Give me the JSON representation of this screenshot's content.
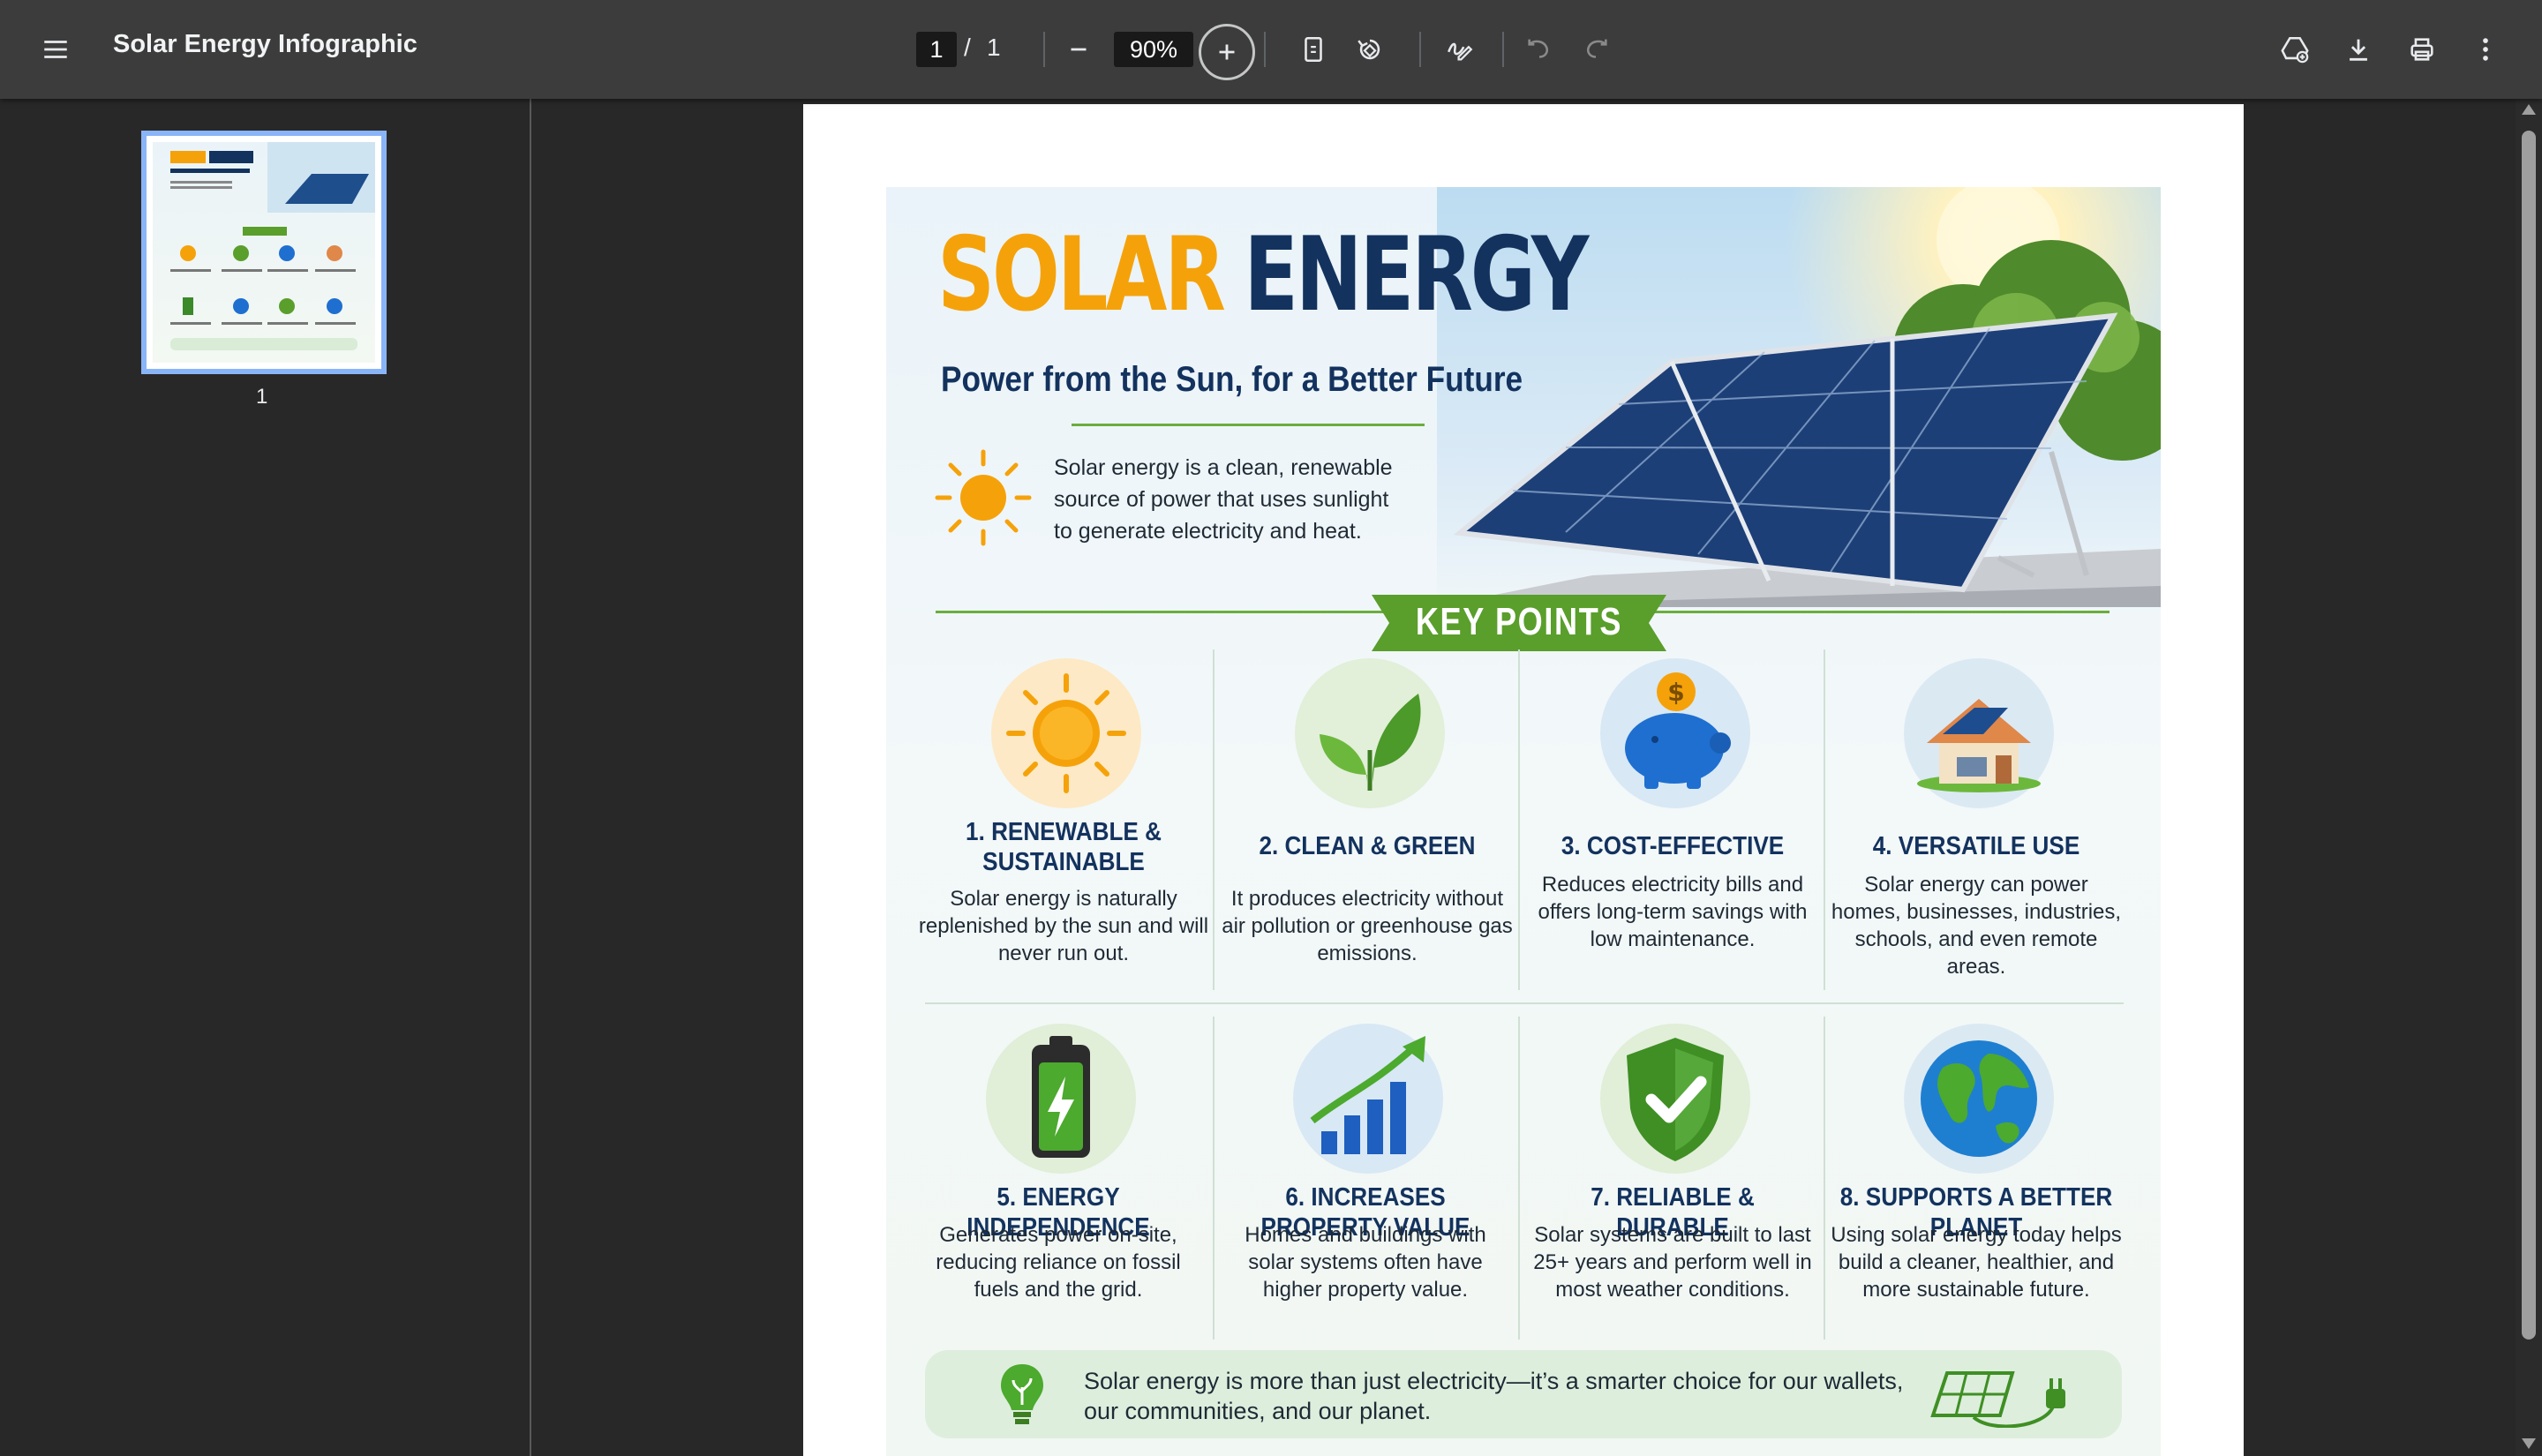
{
  "toolbar": {
    "title": "Solar Energy Infographic",
    "current_page": "1",
    "page_separator": "/",
    "total_pages": "1",
    "zoom": "90%"
  },
  "sidebar": {
    "thumbnail_label": "1"
  },
  "infographic": {
    "title_word1": "SOLAR",
    "title_word2": "ENERGY",
    "subtitle": "Power from the Sun, for a Better Future",
    "intro": "Solar energy is a clean, renewable source of power that uses sunlight to generate electricity and heat.",
    "key_points_label": "KEY POINTS",
    "points": [
      {
        "title": "1. RENEWABLE & SUSTAINABLE",
        "text": "Solar energy is naturally replenished by the sun and will never run out.",
        "icon": "sun-icon"
      },
      {
        "title": "2. CLEAN & GREEN",
        "text": "It produces electricity without air pollution or greenhouse gas emissions.",
        "icon": "leaf-icon"
      },
      {
        "title": "3. COST-EFFECTIVE",
        "text": "Reduces electricity bills and offers long-term savings with low maintenance.",
        "icon": "piggy-bank-icon"
      },
      {
        "title": "4. VERSATILE USE",
        "text": "Solar energy can power homes, businesses, industries, schools, and even remote areas.",
        "icon": "house-icon"
      },
      {
        "title": "5. ENERGY INDEPENDENCE",
        "text": "Generates power on-site, reducing reliance on fossil fuels and the grid.",
        "icon": "battery-icon"
      },
      {
        "title": "6. INCREASES PROPERTY VALUE",
        "text": "Homes and buildings with solar systems often have higher property value.",
        "icon": "growth-chart-icon"
      },
      {
        "title": "7. RELIABLE & DURABLE",
        "text": "Solar systems are built to last 25+ years and perform well in most weather conditions.",
        "icon": "shield-check-icon"
      },
      {
        "title": "8. SUPPORTS A BETTER PLANET",
        "text": "Using solar energy today helps build a cleaner, healthier, and more sustainable future.",
        "icon": "globe-icon"
      }
    ],
    "footer": "Solar energy is more than just electricity—it’s a smarter choice for our wallets, our communities, and our planet."
  },
  "colors": {
    "accent_orange": "#f5a20a",
    "navy": "#13325e",
    "green": "#5a9e2c",
    "thumb_border": "#8ab4f8"
  }
}
